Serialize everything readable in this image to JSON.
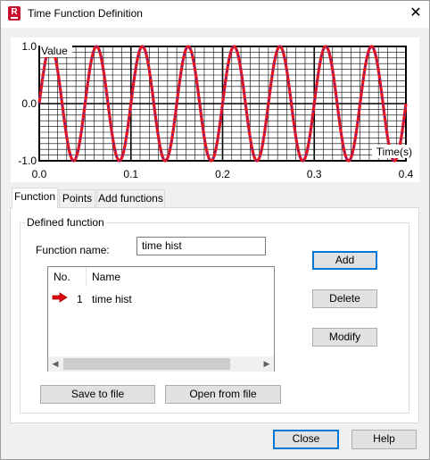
{
  "window": {
    "title": "Time Function Definition",
    "app_icon_letter": "R"
  },
  "chart_data": {
    "type": "line",
    "ylabel": "Value",
    "xlabel": "Time(s)",
    "xlim": [
      0,
      0.4
    ],
    "ylim": [
      -1,
      1
    ],
    "xticks": [
      "0.0",
      "0.1",
      "0.2",
      "0.3",
      "0.4"
    ],
    "yticks": [
      "1.0",
      "0.0",
      "-1.0"
    ],
    "grid": true,
    "series": [
      {
        "function": "sin(2*pi*20*t)",
        "frequency_hz": 20,
        "amplitude": 1.0,
        "color": "#e8141e",
        "marker_color": "#1e2fd0"
      }
    ]
  },
  "tabs": [
    "Function",
    "Points",
    "Add functions"
  ],
  "active_tab": "Function",
  "group": {
    "label": "Defined function"
  },
  "function_name": {
    "label": "Function name:",
    "value": "time hist"
  },
  "list": {
    "headers": [
      "No.",
      "Name"
    ],
    "rows": [
      {
        "no": "1",
        "name": "time hist",
        "current_icon": "red-arrow-icon"
      }
    ]
  },
  "buttons": {
    "add": "Add",
    "delete": "Delete",
    "modify": "Modify",
    "save": "Save to file",
    "open": "Open from file",
    "close": "Close",
    "help": "Help"
  }
}
